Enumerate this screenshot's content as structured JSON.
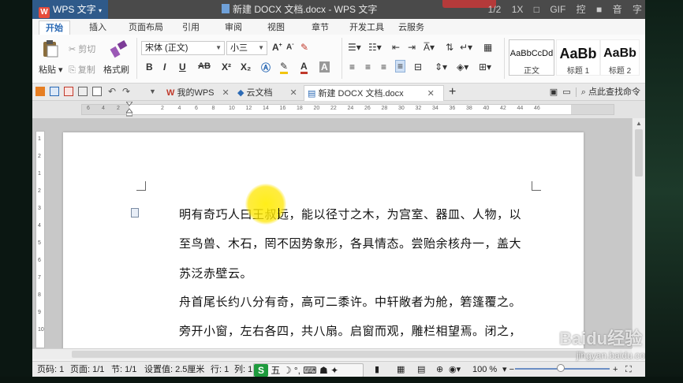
{
  "titlebar": {
    "app_label": "WPS 文字",
    "doc_title": "新建 DOCX 文档.docx - WPS 文字",
    "right_items": [
      "1/2",
      "1X",
      "□",
      "GIF",
      "控",
      "■",
      "音",
      "字"
    ]
  },
  "menu": {
    "tabs": [
      "开始",
      "插入",
      "页面布局",
      "引用",
      "审阅",
      "视图",
      "章节",
      "开发工具",
      "云服务"
    ]
  },
  "ribbon": {
    "paste_label": "粘贴",
    "cut_label": "剪切",
    "copy_label": "复制",
    "format_painter_label": "格式刷",
    "font_name": "宋体 (正文)",
    "font_size": "小三",
    "bold": "B",
    "italic": "I",
    "underline": "U",
    "strike": "AB",
    "superscript": "X²",
    "subscript": "X₂",
    "styles": [
      {
        "preview": "AaBbCcDd",
        "name": "正文"
      },
      {
        "preview": "AaBb",
        "name": "标题 1"
      },
      {
        "preview": "AaBb",
        "name": "标题 2"
      }
    ]
  },
  "tabbar": {
    "tabs": [
      {
        "label": "我的WPS",
        "icon": "wps-logo-icon"
      },
      {
        "label": "云文档",
        "icon": "cloud-icon"
      },
      {
        "label": "新建 DOCX 文档.docx",
        "icon": "document-icon"
      }
    ],
    "new_tab": "+",
    "find_command": "点此查找命令"
  },
  "ruler": {
    "numbers": [
      "6",
      "4",
      "2",
      "2",
      "4",
      "6",
      "8",
      "10",
      "12",
      "14",
      "16",
      "18",
      "20",
      "22",
      "24",
      "26",
      "28",
      "30",
      "32",
      "34",
      "36",
      "38",
      "40",
      "42",
      "44",
      "46"
    ]
  },
  "vruler": {
    "numbers": [
      "1",
      "2",
      "1",
      "2",
      "3",
      "4",
      "5",
      "6",
      "7",
      "8",
      "9",
      "10"
    ]
  },
  "document": {
    "lines": [
      "明有奇巧人曰王叔远，能以径寸之木，为宫室、器皿、人物，以",
      "至鸟兽、木石，罔不因势象形，各具情态。尝贻余核舟一，盖大",
      "苏泛赤壁云。",
      "舟首尾长约八分有奇，高可二黍许。中轩敞者为舱，箬篷覆之。",
      "旁开小窗，左右各四，共八扇。启窗而观，雕栏相望焉。闭之，"
    ]
  },
  "status": {
    "page_num": "页码: 1",
    "pages": "页面: 1/1",
    "section": "节: 1/1",
    "setting": "设置值: 2.5厘米",
    "row": "行: 1",
    "col": "列: 1",
    "zoom": "100 %",
    "ime": "五"
  },
  "watermark": {
    "brand": "Baidu经验",
    "url": "jingyan.baidu.com"
  },
  "colors": {
    "accent": "#2b6ab5",
    "highlight": "#ffec00"
  }
}
